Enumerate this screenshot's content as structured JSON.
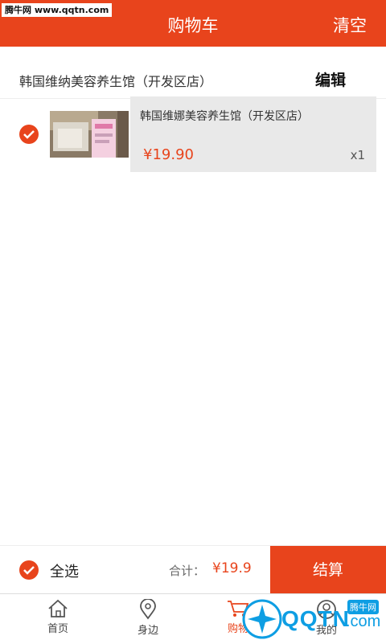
{
  "watermark": {
    "top": "腾牛网 www.qqtn.com",
    "bottom_main": "QQTN",
    "bottom_sub": ".com",
    "bottom_badge": "腾牛网"
  },
  "header": {
    "title": "购物车",
    "clear": "清空"
  },
  "store": {
    "name": "韩国维纳美容养生馆（开发区店）",
    "edit": "编辑"
  },
  "item": {
    "name": "韩国维娜美容养生馆（开发区店）",
    "price": "¥19.90",
    "qty": "x1"
  },
  "footer": {
    "select_all": "全选",
    "total_label": "合计：",
    "total_value": "¥19.9",
    "checkout": "结算"
  },
  "tabs": [
    {
      "label": "首页",
      "icon": "home-icon"
    },
    {
      "label": "身边",
      "icon": "location-icon"
    },
    {
      "label": "购物",
      "icon": "cart-icon"
    },
    {
      "label": "我的",
      "icon": "user-icon"
    }
  ],
  "colors": {
    "accent": "#e8441c",
    "watermark": "#0e9ee3"
  }
}
